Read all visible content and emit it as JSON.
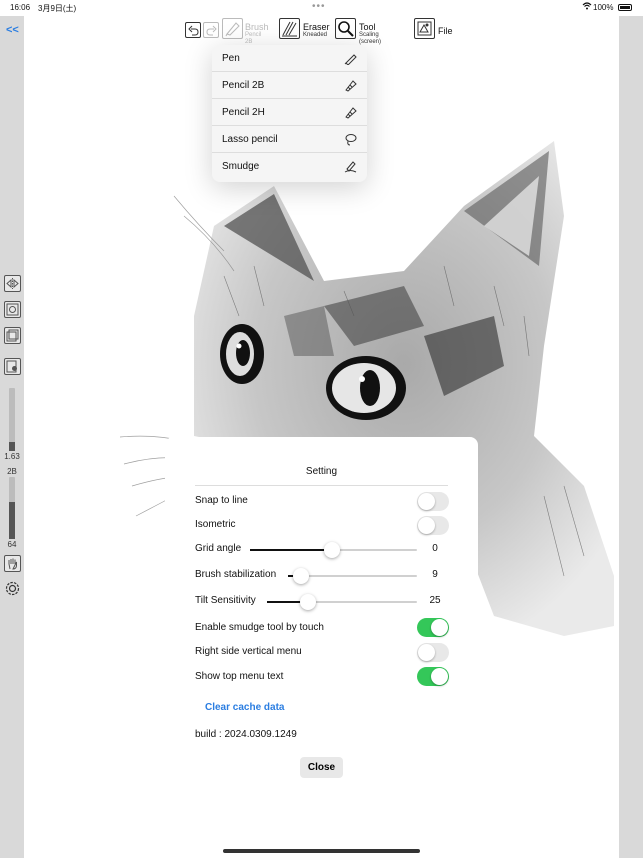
{
  "status": {
    "time": "16:06",
    "date": "3月9日(土)",
    "battery": "100%"
  },
  "nav": {
    "back": "<<"
  },
  "left": {
    "size_value": "1.63",
    "opacity_value": "2B",
    "bottom_value": "64",
    "size_level": 0.15,
    "opacity_level": 0.6
  },
  "toolbar": {
    "brush": {
      "label": "Brush",
      "sub": "Pencil 2B"
    },
    "eraser": {
      "label": "Eraser",
      "sub": "Kneaded"
    },
    "tool": {
      "label": "Tool",
      "sub": "Scaling (screen)"
    },
    "file": {
      "label": "File"
    }
  },
  "menu": {
    "items": [
      {
        "label": "Pen",
        "icon": "pen-icon"
      },
      {
        "label": "Pencil 2B",
        "icon": "pencil-icon"
      },
      {
        "label": "Pencil 2H",
        "icon": "pencil-icon"
      },
      {
        "label": "Lasso pencil",
        "icon": "lasso-icon"
      },
      {
        "label": "Smudge",
        "icon": "smudge-icon"
      }
    ]
  },
  "settings": {
    "title": "Setting",
    "snap": {
      "label": "Snap to line",
      "on": false
    },
    "iso": {
      "label": "Isometric",
      "on": false
    },
    "grid": {
      "label": "Grid angle",
      "value": "0",
      "level": 0.49
    },
    "stab": {
      "label": "Brush stabilization",
      "value": "9",
      "level": 0.1
    },
    "tilt": {
      "label": "Tilt Sensitivity",
      "value": "25",
      "level": 0.27
    },
    "smudge": {
      "label": "Enable smudge tool by touch",
      "on": true
    },
    "rside": {
      "label": "Right side vertical menu",
      "on": false
    },
    "topmenu": {
      "label": "Show top menu text",
      "on": true
    },
    "clear": "Clear cache data",
    "build": "build : 2024.0309.1249",
    "close": "Close"
  },
  "colors": {
    "accent": "#2a7de1",
    "toggle_on": "#34c759",
    "sidebar": "#d9d9d9"
  }
}
